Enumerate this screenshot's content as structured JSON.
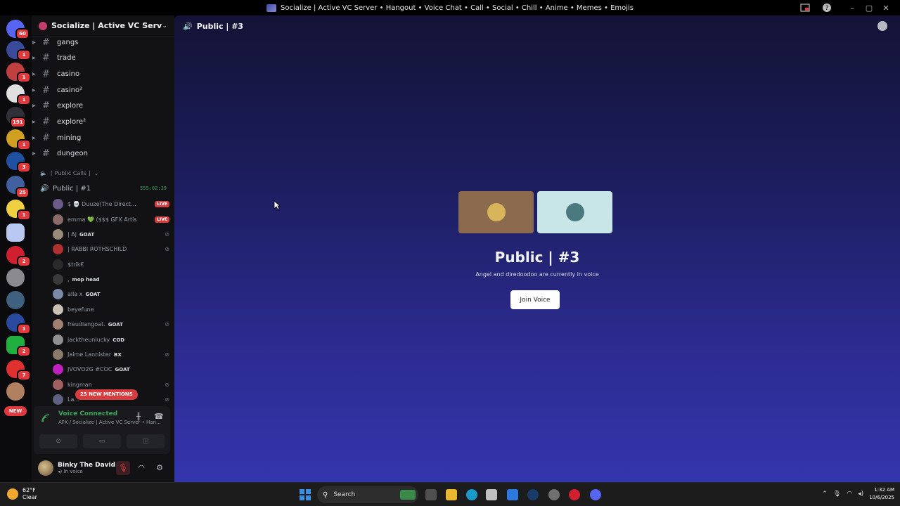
{
  "window": {
    "title": "Socialize | Active VC Server • Hangout • Voice Chat • Call • Social • Chill • Anime • Memes • Emojis"
  },
  "rail": {
    "badges": [
      "60",
      "1",
      "1",
      "1",
      "191",
      "1",
      "3",
      "25",
      "1",
      "2",
      "1",
      "2",
      "1",
      "7"
    ],
    "new_label": "NEW"
  },
  "server": {
    "name": "Socialize | Active VC Server • ..."
  },
  "channels": [
    {
      "name": "gangs"
    },
    {
      "name": "trade"
    },
    {
      "name": "casino"
    },
    {
      "name": "casino²"
    },
    {
      "name": "explore"
    },
    {
      "name": "explore²"
    },
    {
      "name": "mining"
    },
    {
      "name": "dungeon"
    }
  ],
  "category": {
    "label": "⌈ Public Calls ⌋"
  },
  "voice_channel": {
    "name": "Public | #1",
    "timer": "555:02:39"
  },
  "members": [
    {
      "name": "$ 💀 Duuze(The Direct...",
      "tag": "",
      "live": true,
      "color": "#6b5a8a"
    },
    {
      "name": "emma 💚 ($$$ GFX Artist)",
      "tag": "",
      "live": true,
      "color": "#8a6b6b"
    },
    {
      "name": "| Aj",
      "tag": "GOAT",
      "live": false,
      "color": "#9a8a7a"
    },
    {
      "name": "| RABBI ROTHSCHILD",
      "tag": "",
      "live": false,
      "color": "#b03030"
    },
    {
      "name": "$trik€",
      "tag": "",
      "live": false,
      "color": "#2a2a2a"
    },
    {
      "name": ",",
      "tag": "mop head",
      "live": false,
      "color": "#3a3a3a"
    },
    {
      "name": "alla x",
      "tag": "GOAT",
      "live": false,
      "color": "#7a8aa8"
    },
    {
      "name": "beyefune",
      "tag": "",
      "live": false,
      "color": "#c8c0b0"
    },
    {
      "name": "freudiangoat.",
      "tag": "GOAT",
      "live": false,
      "color": "#a08070"
    },
    {
      "name": "jacktheunlucky",
      "tag": "COD",
      "live": false,
      "color": "#909090"
    },
    {
      "name": "Jaime Lannister",
      "tag": "BX",
      "live": false,
      "color": "#8a7a6a"
    },
    {
      "name": "JVOVO2G #COC",
      "tag": "GOAT",
      "live": false,
      "color": "#c020c0"
    },
    {
      "name": "kingman",
      "tag": "",
      "live": false,
      "color": "#a06060"
    },
    {
      "name": "La...",
      "tag": "",
      "live": false,
      "color": "#606080"
    }
  ],
  "mentions": "25 NEW MENTIONS",
  "live_label": "LIVE",
  "voice_panel": {
    "status": "Voice Connected",
    "location": "AFK / Socialize | Active VC Server • Han..."
  },
  "user": {
    "name": "Binky The David",
    "status": "In voice"
  },
  "main": {
    "channel": "Public | #3",
    "title": "Public | #3",
    "description": "Angel and diredoodoo are currently in voice",
    "join_label": "Join Voice",
    "tiles": [
      {
        "bg": "#8b6a4e",
        "avatar": "#d8b45a"
      },
      {
        "bg": "#c8e6e8",
        "avatar": "#4a7a80"
      }
    ]
  },
  "taskbar": {
    "temp": "62°F",
    "weather": "Clear",
    "search": "Search",
    "time": "1:32 AM",
    "date": "10/6/2025"
  },
  "colors": {
    "accent_green": "#3ba55c",
    "danger_red": "#d83c3e",
    "main_bg_top": "#131336",
    "main_bg_bottom": "#3535ad"
  }
}
